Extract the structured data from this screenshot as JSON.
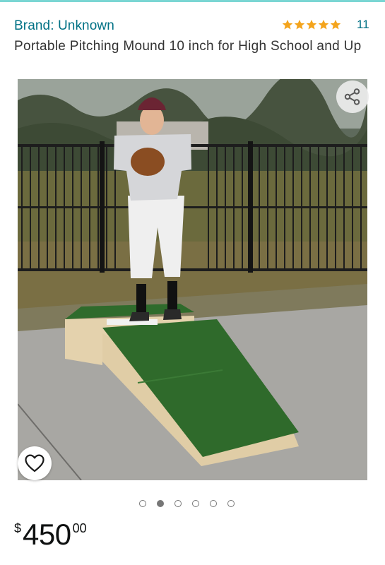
{
  "product": {
    "brand_label": "Brand: Unknown",
    "title": "Portable Pitching Mound 10 inch for High School and Up",
    "rating": {
      "stars": 5,
      "count": "11",
      "star_color": "#f4a41c"
    }
  },
  "gallery": {
    "image_count": 6,
    "active_index": 1,
    "share_icon": "share-icon",
    "favorite_icon": "heart-icon"
  },
  "price": {
    "symbol": "$",
    "whole": "450",
    "fraction": "00"
  },
  "theme": {
    "link_color": "#007185",
    "accent_top": "#7ad6d3"
  }
}
